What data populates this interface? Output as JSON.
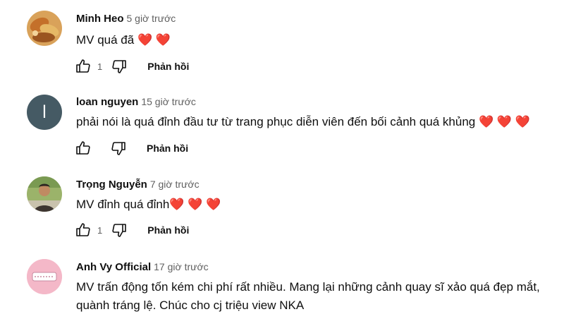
{
  "comments": [
    {
      "author": "Minh Heo",
      "time": "5 giờ trước",
      "text": "MV quá đã",
      "hearts": "❤️ ❤️",
      "likes": "1",
      "reply": "Phản hồi",
      "avatar": {
        "type": "photo",
        "colors": [
          "#c8782e",
          "#e9b25a",
          "#8a4a1c"
        ]
      }
    },
    {
      "author": "loan nguyen",
      "time": "15 giờ trước",
      "text": "phải nói là quá đỉnh đầu tư từ trang phục diễn viên đến bối cảnh quá khủng",
      "hearts": "❤️ ❤️ ❤️",
      "likes": "",
      "reply": "Phản hồi",
      "avatar": {
        "type": "letter",
        "letter": "l",
        "color": "#455a64"
      }
    },
    {
      "author": "Trọng Nguyễn",
      "time": "7 giờ trước",
      "text": "MV đỉnh quá đỉnh",
      "hearts": "❤️ ❤️ ❤️",
      "likes": "1",
      "reply": "Phản hồi",
      "avatar": {
        "type": "photo",
        "colors": [
          "#9bb36a",
          "#5b4a3c",
          "#dcd6c6"
        ]
      }
    },
    {
      "author": "Anh Vy Official",
      "time": "17 giờ trước",
      "text": "MV trấn động tốn kém chi phí rất nhiều. Mang lại những cảnh quay sĩ xảo quá đẹp mắt, quành tráng lệ. Chúc cho cj triệu view NKA",
      "hearts": "",
      "avatar": {
        "type": "logo",
        "color": "#f4b8c8"
      }
    }
  ],
  "icons": {
    "like": "thumb-up-icon",
    "dislike": "thumb-down-icon"
  }
}
